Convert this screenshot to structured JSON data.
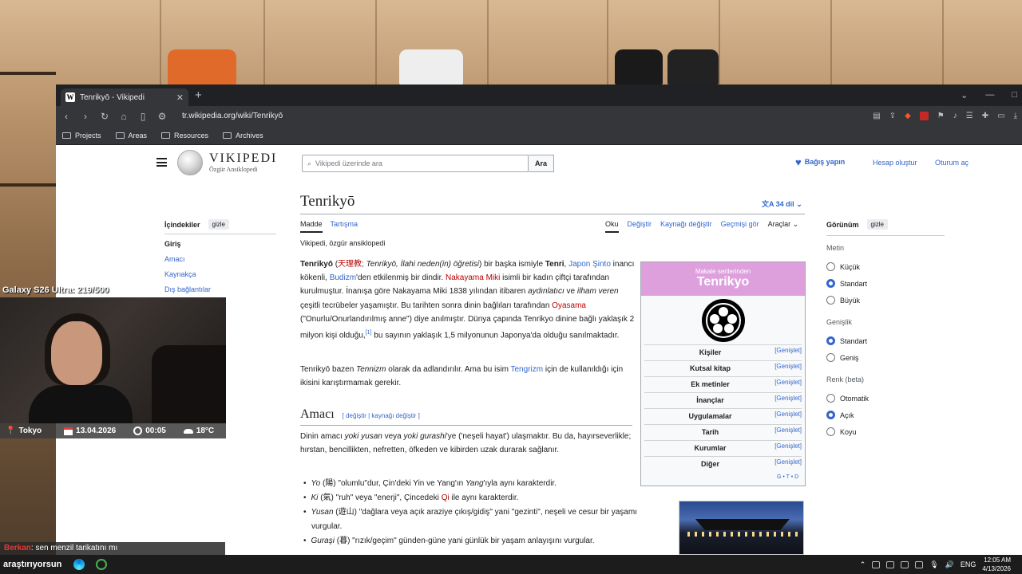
{
  "browser": {
    "tab_title": "Tenrikyō - Vikipedi",
    "tab_icon": "W",
    "url": "tr.wikipedia.org/wiki/Tenrikyō",
    "bookmarks": [
      "Projects",
      "Areas",
      "Resources",
      "Archives"
    ]
  },
  "wiki": {
    "logo_title": "Vikipedi",
    "logo_subtitle": "Özgür Ansiklopedi",
    "search_placeholder": "Vikipedi üzerinde ara",
    "search_button": "Ara",
    "donate": "Bağış yapın",
    "create_account": "Hesap oluştur",
    "login": "Oturum aç",
    "page_title": "Tenrikyō",
    "languages": "34 dil",
    "tabs_left": [
      "Madde",
      "Tartışma"
    ],
    "tabs_right": [
      "Oku",
      "Değiştir",
      "Kaynağı değiştir",
      "Geçmişi gör",
      "Araçlar"
    ],
    "tagline": "Vikipedi, özgür ansiklopedi",
    "toc": {
      "title": "İçindekiler",
      "hide": "gizle",
      "items": [
        "Giriş",
        "Amacı",
        "Kaynakça",
        "Dış bağlantılar"
      ]
    },
    "intro": {
      "bold1": "Tenrikyō",
      "kanji": "天理教",
      "alt_names": "Tenrikyō, İlahi neden(in) öğretisi",
      "t1": ") bir başka ismiyle ",
      "bold2": "Tenri",
      "link_shinto": "Japon Şinto",
      "t2": " inancı kökenli, ",
      "link_budizm": "Budizm",
      "t3": "'den etkilenmiş bir dindir. ",
      "link_nakayama": "Nakayama Miki",
      "t4": " isimli bir kadın çiftçi tarafından kurulmuştur. İnanışa göre Nakayama Miki 1838 yılından itibaren ",
      "i1": "aydınlatıcı",
      "t5": " ve ",
      "i2": "ilham veren",
      "t6": " çeşitli tecrübeler yaşamıştır. Bu tarihten sonra dinin bağlıları tarafından ",
      "link_oyasama": "Oyasama",
      "t7": " (\"Onurlu/Onurlandırılmış anne\") diye anılmıştır. Dünya çapında Tenrikyo dinine bağlı yaklaşık 2 milyon kişi olduğu,",
      "ref": "[1]",
      "t8": " bu sayının yaklaşık 1,5 milyonunun Japonya'da olduğu sanılmaktadır."
    },
    "para2": {
      "t1": "Tenrikyō bazen ",
      "i1": "Tennizm",
      "t2": " olarak da adlandırılır. Ama bu isim ",
      "link": "Tengrizm",
      "t3": " için de kullanıldığı için ikisini karıştırmamak gerekir."
    },
    "section": {
      "title": "Amacı",
      "edit": "[ değiştir | kaynağı değiştir ]",
      "t1": "Dinin amacı ",
      "i1": "yoki yusan",
      "t2": " veya ",
      "i2": "yoki gurashi",
      "t3": "'ye ('neşeli hayat') ulaşmaktır. Bu da, hayırseverlikle; hırstan, bencillikten, nefretten, öfkeden ve kibirden uzak durarak sağlanır."
    },
    "bullets": [
      {
        "i": "Yo",
        "rest1": " (陽) \"olumlu\"dur, Çin'deki Yin ve Yang'ın ",
        "i2": "Yang",
        "rest2": "'ıyla aynı karakterdir."
      },
      {
        "i": "Ki",
        "rest1": " (氣) \"ruh\" veya \"enerji\", Çincedeki ",
        "link": "Qi",
        "rest2": " ile aynı karakterdir."
      },
      {
        "i": "Yusan",
        "rest1": " (遊山) \"dağlara veya açık araziye çıkış/gidiş\" yani \"gezinti\", neşeli ve cesur bir yaşamı vurgular.",
        "rest2": ""
      },
      {
        "i": "Guraşi",
        "rest1": " (暮) \"rızık/geçim\" günden-güne yani günlük bir yaşam anlayışını vurgular.",
        "rest2": ""
      }
    ],
    "infobox": {
      "subtitle": "Makale serilerinden",
      "title": "Tenrikyo",
      "expand": "[Genişlet]",
      "rows": [
        "Kişiler",
        "Kutsal kitap",
        "Ek metinler",
        "İnançlar",
        "Uygulamalar",
        "Tarih",
        "Kurumlar",
        "Diğer"
      ],
      "vte": "G • T • D",
      "header_color": "#dda0dd"
    },
    "appearance": {
      "title": "Görünüm",
      "hide": "gizle",
      "groups": [
        {
          "label": "Metin",
          "options": [
            "Küçük",
            "Standart",
            "Büyük"
          ],
          "selected": 1
        },
        {
          "label": "Genişlik",
          "options": [
            "Standart",
            "Geniş"
          ],
          "selected": 0
        },
        {
          "label": "Renk (beta)",
          "options": [
            "Otomatik",
            "Açık",
            "Koyu"
          ],
          "selected": 1
        }
      ]
    },
    "link_color": "#3366cc",
    "redlink_color": "#ba0000"
  },
  "stream": {
    "goal": "Galaxy S26 Ultra: 219/500",
    "location": "Tokyo",
    "date": "13.04.2026",
    "time": "00:05",
    "temp": "18°C",
    "chat_user": "Berkan",
    "chat_msg": ": sen menzil tarikatını mı"
  },
  "taskbar": {
    "search_text": "araştırıyorsun",
    "lang": "ENG",
    "time": "12:05 AM",
    "date": "4/13/2026"
  }
}
